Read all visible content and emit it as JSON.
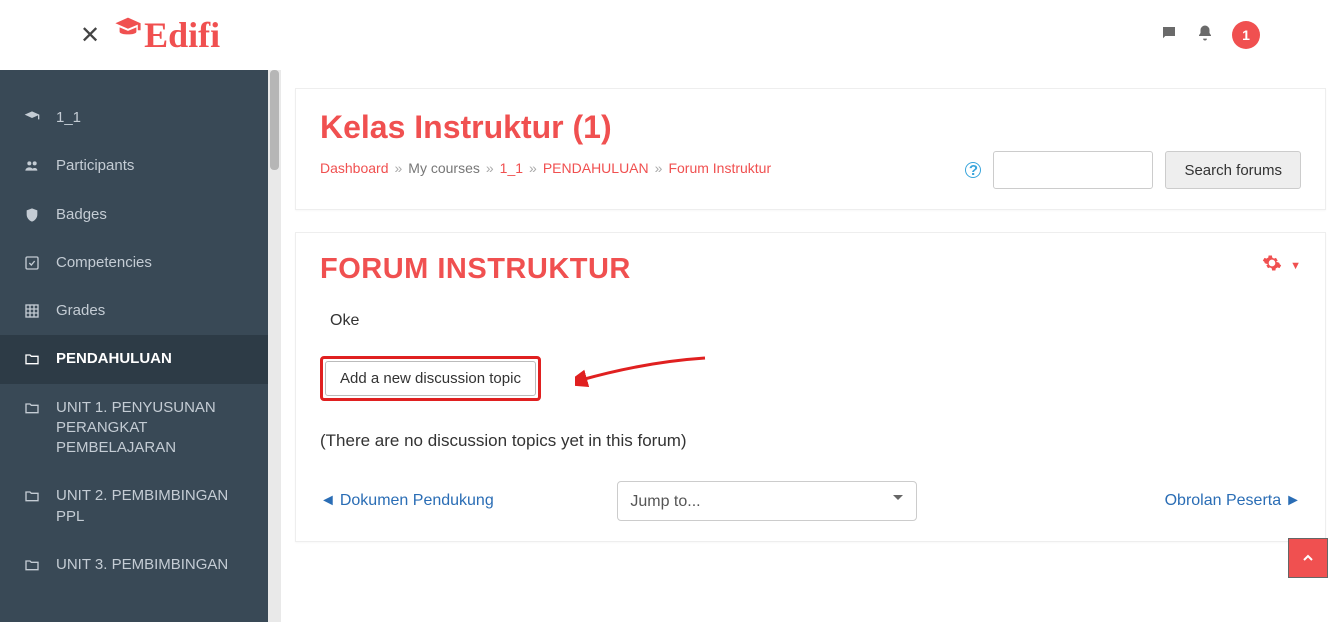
{
  "brand": {
    "name": "Edifi"
  },
  "nav": {
    "badge": "1"
  },
  "sidebar": {
    "items": [
      {
        "icon": "graduation-cap-icon",
        "label": "1_1"
      },
      {
        "icon": "users-icon",
        "label": "Participants"
      },
      {
        "icon": "shield-icon",
        "label": "Badges"
      },
      {
        "icon": "check-square-icon",
        "label": "Competencies"
      },
      {
        "icon": "grid-icon",
        "label": "Grades"
      },
      {
        "icon": "folder-icon",
        "label": "PENDAHULUAN"
      },
      {
        "icon": "folder-icon",
        "label": "UNIT 1. PENYUSUNAN PERANGKAT PEMBELAJARAN"
      },
      {
        "icon": "folder-icon",
        "label": "UNIT 2. PEMBIMBINGAN PPL"
      },
      {
        "icon": "folder-icon",
        "label": "UNIT 3. PEMBIMBINGAN"
      }
    ],
    "active_index": 5
  },
  "header": {
    "title": "Kelas Instruktur (1)",
    "breadcrumb": {
      "dashboard": "Dashboard",
      "mycourses": "My courses",
      "course": "1_1",
      "topic": "PENDAHULUAN",
      "page": "Forum Instruktur"
    },
    "search_btn": "Search forums"
  },
  "forum": {
    "title": "FORUM INSTRUKTUR",
    "body": "Oke",
    "add_btn": "Add a new discussion topic",
    "empty": "(There are no discussion topics yet in this forum)",
    "prev": "Dokumen Pendukung",
    "next": "Obrolan Peserta",
    "jump": "Jump to..."
  },
  "colors": {
    "accent": "#f05050"
  }
}
